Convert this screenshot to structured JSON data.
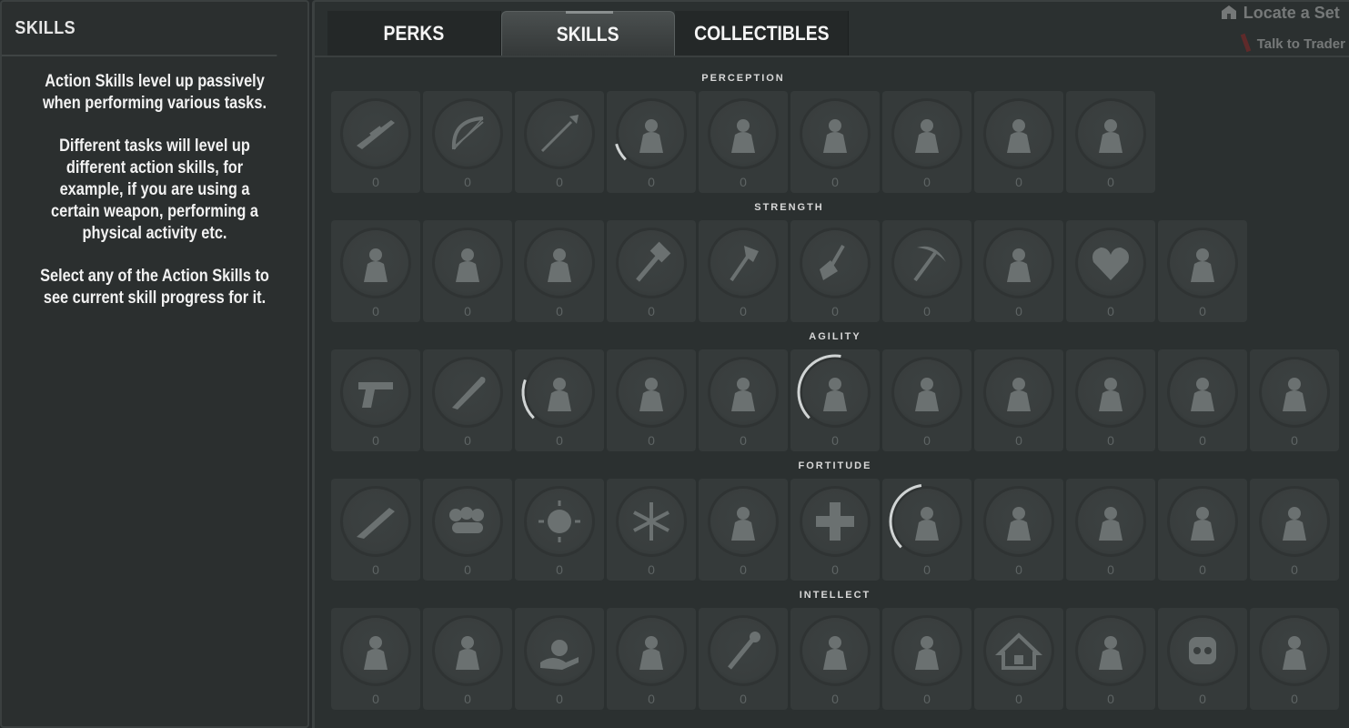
{
  "left_panel": {
    "title": "SKILLS",
    "paragraphs": [
      "Action Skills level up passively when performing various tasks.",
      "Different tasks will level up different action skills, for example, if you are using a certain weapon, performing a physical activity etc.",
      "Select any of the Action Skills to see current skill progress for it."
    ]
  },
  "tabs": [
    {
      "label": "PERKS",
      "active": false
    },
    {
      "label": "SKILLS",
      "active": true
    },
    {
      "label": "COLLECTIBLES",
      "active": false
    }
  ],
  "hud": {
    "line1": "Locate a Set",
    "line2": "Talk to Trader"
  },
  "categories": [
    {
      "name": "PERCEPTION",
      "skills": [
        {
          "icon": "rifle-icon",
          "level": "0",
          "progress": 0
        },
        {
          "icon": "bow-icon",
          "level": "0",
          "progress": 0
        },
        {
          "icon": "spear-icon",
          "level": "0",
          "progress": 0
        },
        {
          "icon": "scavenger-icon",
          "level": "0",
          "progress": 0.08
        },
        {
          "icon": "butcher-icon",
          "level": "0",
          "progress": 0
        },
        {
          "icon": "lock-pick-icon",
          "level": "0",
          "progress": 0
        },
        {
          "icon": "looter-icon",
          "level": "0",
          "progress": 0
        },
        {
          "icon": "demolitions-icon",
          "level": "0",
          "progress": 0
        },
        {
          "icon": "treasure-hunter-icon",
          "level": "0",
          "progress": 0
        }
      ]
    },
    {
      "name": "STRENGTH",
      "skills": [
        {
          "icon": "flex-icon",
          "level": "0",
          "progress": 0
        },
        {
          "icon": "assault-rifle-icon",
          "level": "0",
          "progress": 0
        },
        {
          "icon": "club-icon",
          "level": "0",
          "progress": 0
        },
        {
          "icon": "sledgehammer-icon",
          "level": "0",
          "progress": 0
        },
        {
          "icon": "axe-icon",
          "level": "0",
          "progress": 0
        },
        {
          "icon": "shovel-icon",
          "level": "0",
          "progress": 0
        },
        {
          "icon": "pickaxe-icon",
          "level": "0",
          "progress": 0
        },
        {
          "icon": "farmer-icon",
          "level": "0",
          "progress": 0
        },
        {
          "icon": "heart-icon",
          "level": "0",
          "progress": 0
        },
        {
          "icon": "miner-icon",
          "level": "0",
          "progress": 0
        }
      ]
    },
    {
      "name": "AGILITY",
      "skills": [
        {
          "icon": "pistol-icon",
          "level": "0",
          "progress": 0
        },
        {
          "icon": "machete-icon",
          "level": "0",
          "progress": 0
        },
        {
          "icon": "treadmill-runner-icon",
          "level": "0",
          "progress": 0.18
        },
        {
          "icon": "sneak-icon",
          "level": "0",
          "progress": 0
        },
        {
          "icon": "ninja-icon",
          "level": "0",
          "progress": 0
        },
        {
          "icon": "parkour-icon",
          "level": "0",
          "progress": 0.4
        },
        {
          "icon": "acrobat-icon",
          "level": "0",
          "progress": 0
        },
        {
          "icon": "hidden-strike-icon",
          "level": "0",
          "progress": 0
        },
        {
          "icon": "light-armor-icon",
          "level": "0",
          "progress": 0
        },
        {
          "icon": "deep-cuts-icon",
          "level": "0",
          "progress": 0
        },
        {
          "icon": "run-and-gun-icon",
          "level": "0",
          "progress": 0
        }
      ]
    },
    {
      "name": "FORTITUDE",
      "skills": [
        {
          "icon": "shotgun-icon",
          "level": "0",
          "progress": 0
        },
        {
          "icon": "knuckles-icon",
          "level": "0",
          "progress": 0
        },
        {
          "icon": "sun-icon",
          "level": "0",
          "progress": 0
        },
        {
          "icon": "snowflake-icon",
          "level": "0",
          "progress": 0
        },
        {
          "icon": "brawler-icon",
          "level": "0",
          "progress": 0
        },
        {
          "icon": "medic-icon",
          "level": "0",
          "progress": 0
        },
        {
          "icon": "heavy-armor-icon",
          "level": "0",
          "progress": 0.35
        },
        {
          "icon": "survivor-icon",
          "level": "0",
          "progress": 0
        },
        {
          "icon": "healing-factor-icon",
          "level": "0",
          "progress": 0
        },
        {
          "icon": "rule-one-icon",
          "level": "0",
          "progress": 0
        },
        {
          "icon": "siphoning-icon",
          "level": "0",
          "progress": 0
        }
      ]
    },
    {
      "name": "INTELLECT",
      "skills": [
        {
          "icon": "smg-icon",
          "level": "0",
          "progress": 0
        },
        {
          "icon": "stun-baton-icon",
          "level": "0",
          "progress": 0
        },
        {
          "icon": "money-hand-icon",
          "level": "0",
          "progress": 0
        },
        {
          "icon": "climber-flag-icon",
          "level": "0",
          "progress": 0
        },
        {
          "icon": "wrench-icon",
          "level": "0",
          "progress": 0
        },
        {
          "icon": "multitool-icon",
          "level": "0",
          "progress": 0
        },
        {
          "icon": "vehicle-icon",
          "level": "0",
          "progress": 0
        },
        {
          "icon": "house-icon",
          "level": "0",
          "progress": 0
        },
        {
          "icon": "turret-icon",
          "level": "0",
          "progress": 0
        },
        {
          "icon": "robot-icon",
          "level": "0",
          "progress": 0
        },
        {
          "icon": "electrician-icon",
          "level": "0",
          "progress": 0
        }
      ]
    }
  ],
  "colors": {
    "background": "#262a2b",
    "tile": "#353a3a",
    "disc": "#393e3e",
    "icon": "#6b7171",
    "level_text": "#5e6464",
    "progress_ring": "#d0d4d4"
  }
}
